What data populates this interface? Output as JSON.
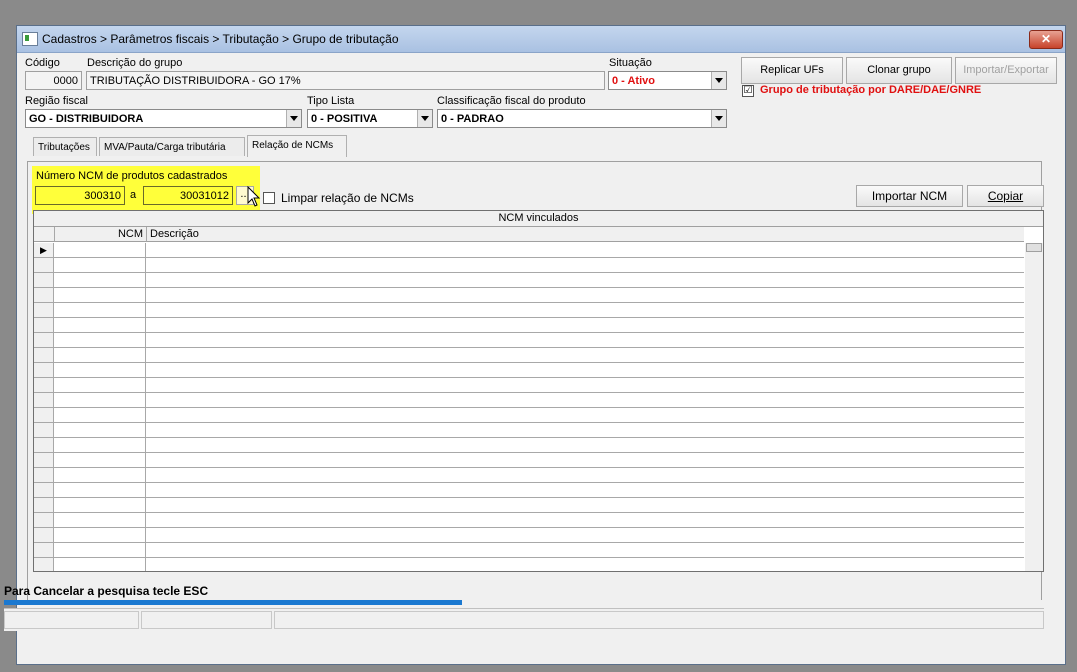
{
  "window": {
    "title": "Cadastros > Parâmetros fiscais > Tributação > Grupo de tributação",
    "close": "✕"
  },
  "form": {
    "codigo_label": "Código",
    "codigo_value": "0000",
    "descricao_label": "Descrição do grupo",
    "descricao_value": "TRIBUTAÇÃO DISTRIBUIDORA - GO 17%",
    "situacao_label": "Situação",
    "situacao_value": "0 - Ativo",
    "regiao_label": "Região fiscal",
    "regiao_value": "GO - DISTRIBUIDORA",
    "tipo_lista_label": "Tipo Lista",
    "tipo_lista_value": "0 - POSITIVA",
    "classificacao_label": "Classificação fiscal do produto",
    "classificacao_value": "0 - PADRAO"
  },
  "buttons": {
    "replicar": "Replicar UFs",
    "clonar": "Clonar grupo",
    "importar_exportar": "Importar/Exportar",
    "importar_ncm": "Importar NCM",
    "copiar": "Copiar",
    "search_btn": "..."
  },
  "dare_checkbox": {
    "label": "Grupo de tributação por DARE/DAE/GNRE",
    "checked": "☑"
  },
  "tabs": [
    {
      "label": "Tributações"
    },
    {
      "label": "MVA/Pauta/Carga tributária"
    },
    {
      "label": "Relação de NCMs"
    }
  ],
  "ncm_panel": {
    "range_label": "Número  NCM de produtos cadastrados",
    "from_value": "300310",
    "sep": "a",
    "to_value": "30031012",
    "limpar_label": "Limpar relação de NCMs"
  },
  "grid": {
    "caption": "NCM vinculados",
    "col_ncm": "NCM",
    "col_descricao": "Descrição",
    "row_count": 22,
    "current_marker": "▶"
  },
  "status": {
    "message": "Para Cancelar a pesquisa tecle ESC",
    "progress": 0.44
  },
  "colors": {
    "accent_red": "#e01010",
    "highlight_yellow": "#ffff3a",
    "progress_blue": "#1a78d0"
  }
}
